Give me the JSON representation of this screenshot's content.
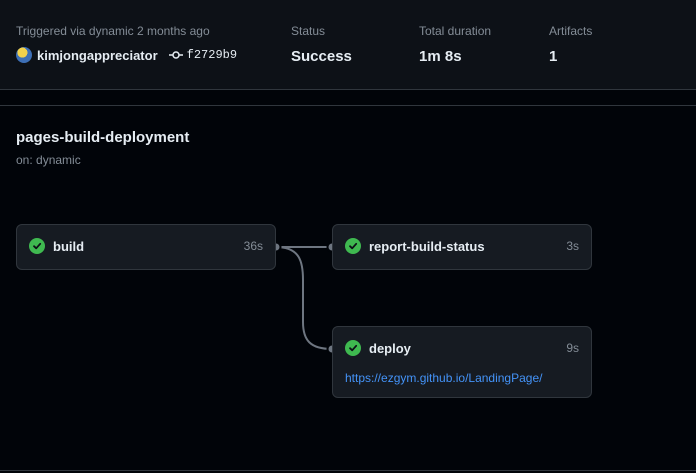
{
  "summary": {
    "trigger_text": "Triggered via dynamic 2 months ago",
    "actor": "kimjongappreciator",
    "commit_sha": "f2729b9",
    "status_label": "Status",
    "status_value": "Success",
    "duration_label": "Total duration",
    "duration_value": "1m 8s",
    "artifacts_label": "Artifacts",
    "artifacts_value": "1"
  },
  "workflow": {
    "name": "pages-build-deployment",
    "trigger": "on: dynamic"
  },
  "jobs": [
    {
      "name": "build",
      "duration": "36s",
      "status": "success"
    },
    {
      "name": "report-build-status",
      "duration": "3s",
      "status": "success"
    },
    {
      "name": "deploy",
      "duration": "9s",
      "status": "success",
      "link": "https://ezgym.github.io/LandingPage/"
    }
  ],
  "icons": {
    "avatar": "user-avatar",
    "commit": "git-commit-icon",
    "check": "check-circle-icon"
  },
  "colors": {
    "background": "#010409",
    "panel": "#0d1117",
    "card": "#161b22",
    "border": "#30363d",
    "success": "#3fb950",
    "link": "#4493f8",
    "muted": "#848d97"
  }
}
